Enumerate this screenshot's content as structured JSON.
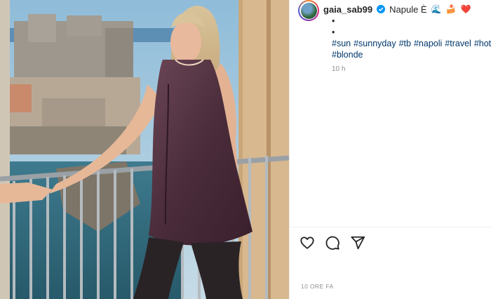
{
  "post": {
    "username": "gaia_sab99",
    "location_text": "Napule È",
    "location_emojis": [
      "🌊",
      "🍰",
      "❤️"
    ],
    "caption_dots": [
      "•",
      "•"
    ],
    "hashtags": [
      "#sun",
      "#sunnyday",
      "#tb",
      "#napoli",
      "#travel",
      "#hot",
      "#blonde"
    ],
    "relative_time": "10 h",
    "timestamp_label": "10 ORE FA"
  },
  "icons": {
    "verified": "verified-badge-icon",
    "like": "heart-icon",
    "comment": "comment-icon",
    "share": "share-icon"
  },
  "colors": {
    "verified_blue": "#0095f6",
    "hashtag_link": "#00376b",
    "muted_text": "#8e8e8e",
    "text": "#262626"
  }
}
